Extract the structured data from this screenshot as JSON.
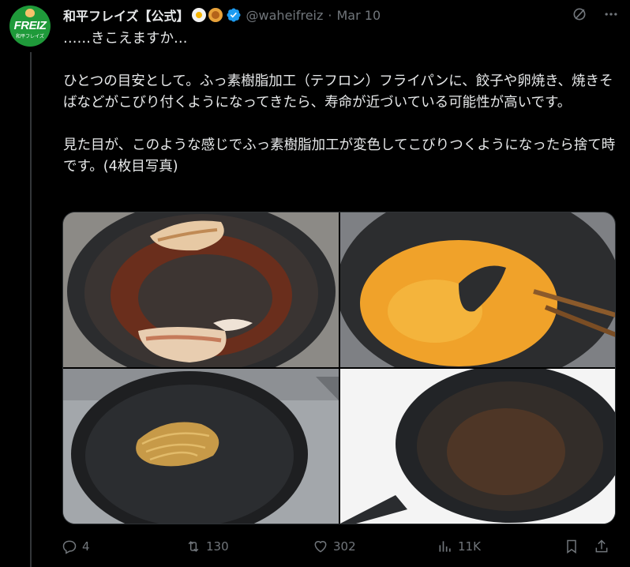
{
  "post": {
    "display_name": "和平フレイズ【公式】",
    "handle": "@waheifreiz",
    "separator": "·",
    "date": "Mar 10",
    "text": "……きこえますか…\n\nひとつの目安として。ふっ素樹脂加工（テフロン）フライパンに、餃子や卵焼き、焼きそばなどがこびり付くようになってきたら、寿命が近づいている可能性が高いです。\n\n見た目が、このような感じでふっ素樹脂加工が変色してこびりつくようになったら捨て時です。(4枚目写真)"
  },
  "avatar": {
    "logo_text": "FREIZ",
    "logo_sub": "和平フレイズ"
  },
  "icons": {
    "emoji_1": "fried-egg-pan-icon",
    "emoji_2": "gyoza-icon",
    "verified": "verified-badge-icon",
    "grok": "grok-icon",
    "more": "more-icon"
  },
  "media": {
    "photos": [
      {
        "name": "photo-1-gyoza-stuck-pan"
      },
      {
        "name": "photo-2-scrambled-egg-stuck-pan"
      },
      {
        "name": "photo-3-yakisoba-stuck-pan"
      },
      {
        "name": "photo-4-discolored-pan"
      }
    ]
  },
  "actions": {
    "replies": "4",
    "reposts": "130",
    "likes": "302",
    "views": "11K"
  },
  "colors": {
    "background": "#000000",
    "text": "#e7e9ea",
    "muted": "#71767b",
    "verified": "#1d9bf0",
    "avatar_bg": "#1f9a3a"
  }
}
